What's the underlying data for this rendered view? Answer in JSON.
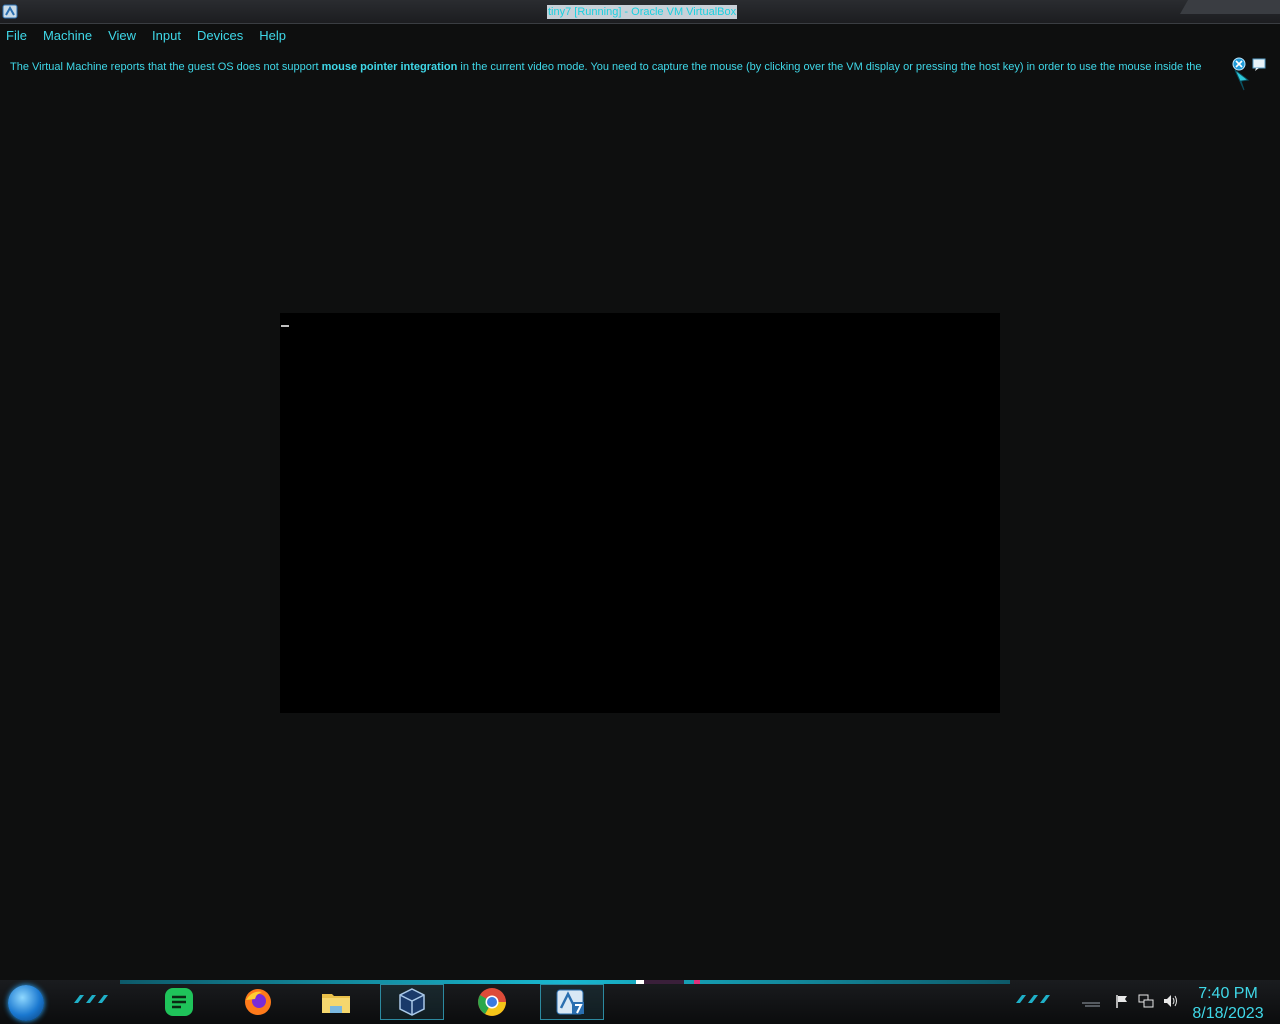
{
  "window": {
    "title": "tiny7 [Running] - Oracle VM VirtualBox",
    "app_icon": "virtualbox-window-icon"
  },
  "menu": {
    "items": [
      "File",
      "Machine",
      "View",
      "Input",
      "Devices",
      "Help"
    ]
  },
  "notice": {
    "text_before": "The Virtual Machine reports that the guest OS does not support ",
    "bold": "mouse pointer integration",
    "text_after": " in the current video mode. You need to capture the mouse (by clicking over the VM display or pressing the host key) in order to use the mouse inside the",
    "icons": [
      "close-notice-icon",
      "toggle-notice-icon",
      "mouse-capture-icon"
    ]
  },
  "vm": {
    "screen_color": "#000000",
    "cursor": "text-cursor"
  },
  "taskbar": {
    "start": "start-orb-icon",
    "pinned": [
      {
        "name": "notes-app-icon",
        "active": false
      },
      {
        "name": "firefox-icon",
        "active": false
      },
      {
        "name": "file-explorer-icon",
        "active": false
      },
      {
        "name": "virtualbox-icon",
        "active": true
      },
      {
        "name": "chrome-icon",
        "active": false
      },
      {
        "name": "virtualbox-vm-tiny7-icon",
        "active": true
      }
    ],
    "tray": [
      "show-hidden-icon",
      "action-center-flag-icon",
      "network-icon",
      "volume-icon"
    ],
    "clock": {
      "time": "7:40 PM",
      "date": "8/18/2023"
    }
  },
  "colors": {
    "accent": "#3fd8e8",
    "background": "#0e0f0f",
    "taskbar_glow": "#19b8d0"
  }
}
